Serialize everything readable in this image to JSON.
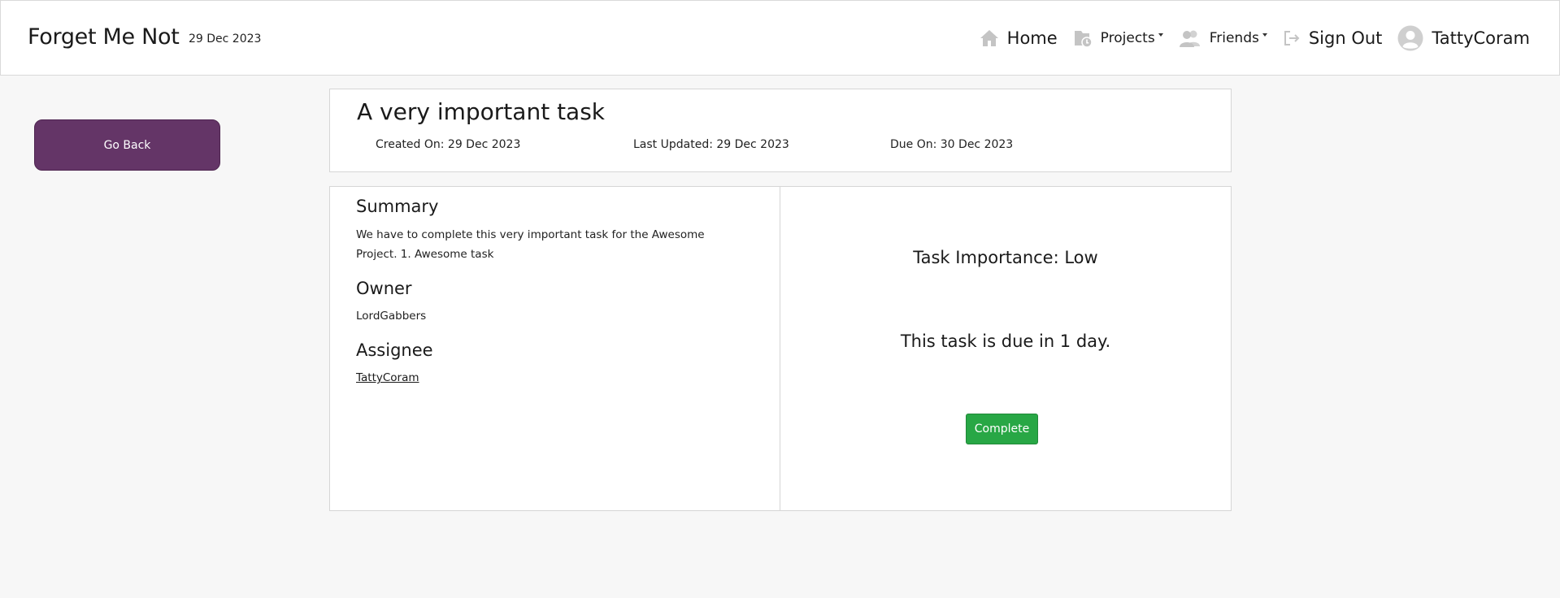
{
  "navbar": {
    "brand": "Forget Me Not",
    "date": "29 Dec 2023",
    "items": {
      "home": {
        "label": "Home",
        "icon": "home-icon"
      },
      "projects": {
        "label": "Projects",
        "icon": "project-folder-icon"
      },
      "friends": {
        "label": "Friends",
        "icon": "friends-icon"
      },
      "signout": {
        "label": "Sign Out",
        "icon": "sign-out-icon"
      },
      "user": {
        "label": "TattyCoram",
        "icon": "avatar-icon"
      }
    }
  },
  "sidebar": {
    "go_back_label": "Go Back"
  },
  "task": {
    "title": "A very important task",
    "created": "Created On: 29 Dec 2023",
    "updated": "Last Updated: 29 Dec 2023",
    "due": "Due On: 30 Dec 2023"
  },
  "details": {
    "summary_heading": "Summary",
    "summary_text": "We have to complete this very important task for the Awesome Project. 1. Awesome task",
    "owner_heading": "Owner",
    "owner_name": "LordGabbers",
    "assignee_heading": "Assignee",
    "assignee_name": "TattyCoram"
  },
  "status": {
    "importance": "Task Importance: Low",
    "due_message": "This task is due in 1 day.",
    "complete_label": "Complete"
  },
  "colors": {
    "accent": "#643567",
    "success": "#28a745",
    "background": "#f7f7f7",
    "icon_gray": "#c4c4c4"
  }
}
